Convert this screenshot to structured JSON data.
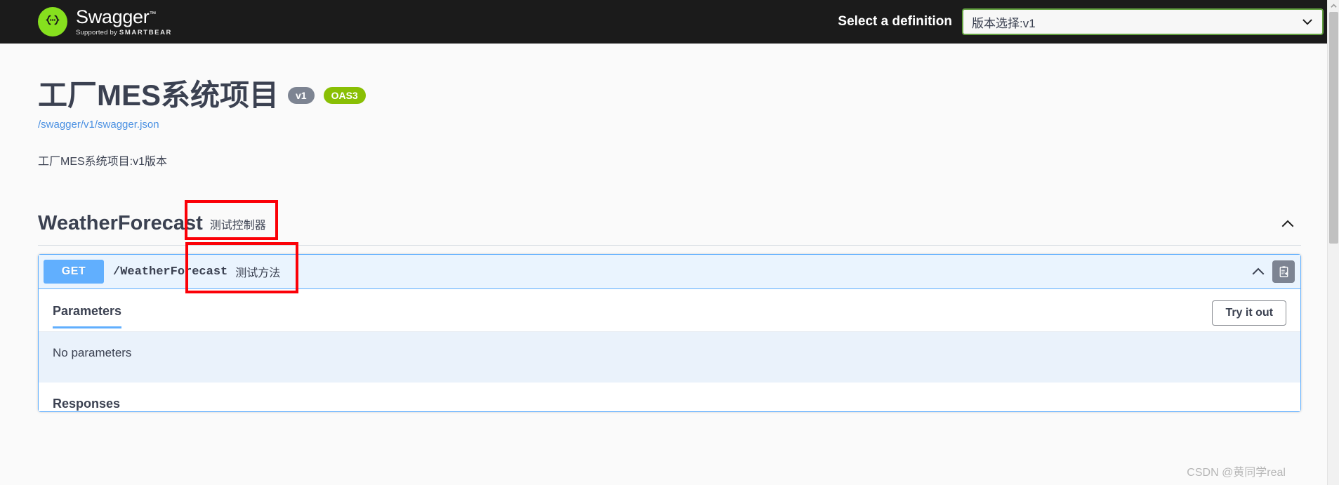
{
  "topbar": {
    "logo_name": "Swagger",
    "logo_trademark": "™",
    "logo_supported_by": "Supported by",
    "logo_brand": "SMARTBEAR",
    "select_definition_label": "Select a definition",
    "definition_value": "版本选择:v1",
    "chevron_icon": "chevron-down-icon"
  },
  "info": {
    "title": "工厂MES系统项目",
    "version_badge": "v1",
    "oas_badge": "OAS3",
    "spec_url": "/swagger/v1/swagger.json",
    "description": "工厂MES系统项目:v1版本"
  },
  "tag": {
    "name": "WeatherForecast",
    "description": "测试控制器",
    "collapse_icon": "chevron-up-icon"
  },
  "operation": {
    "method": "GET",
    "path": "/WeatherForecast",
    "summary": "测试方法",
    "collapse_icon": "chevron-up-icon",
    "copy_icon": "copy-to-clipboard-icon",
    "parameters_tab": "Parameters",
    "try_it_out_label": "Try it out",
    "no_parameters_text": "No parameters",
    "responses_title": "Responses"
  },
  "watermark": "CSDN @黄同学real",
  "colors": {
    "topbar_bg": "#1b1b1b",
    "logo_green": "#86e01e",
    "select_border_green": "#62a03f",
    "get_blue": "#61affe",
    "opblock_bg": "#eaf4fe",
    "annotation_red": "#fb0007",
    "link_blue": "#4a90e2",
    "oas_badge_green": "#89bf04",
    "version_badge_grey": "#7d8492"
  }
}
